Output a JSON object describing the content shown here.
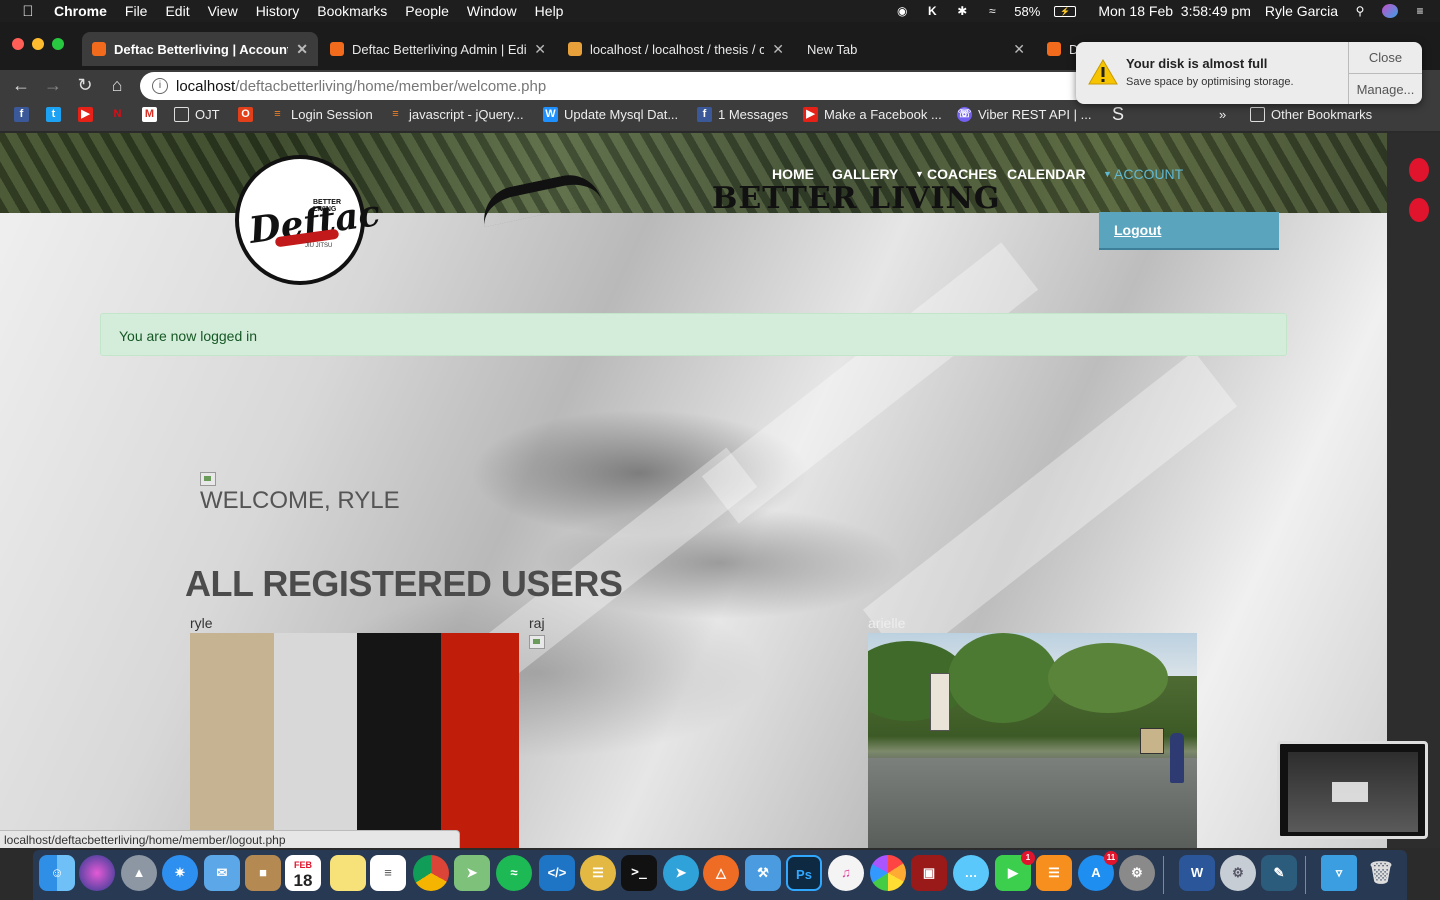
{
  "menubar": {
    "app_name": "Chrome",
    "menus": [
      "File",
      "Edit",
      "View",
      "History",
      "Bookmarks",
      "People",
      "Window",
      "Help"
    ],
    "battery": "58%",
    "datetime": "Mon 18 Feb  3:58:49 pm",
    "user": "Ryle Garcia"
  },
  "tabs": [
    {
      "title": "Deftac Betterliving | Account",
      "active": true
    },
    {
      "title": "Deftac Betterliving Admin | Edi"
    },
    {
      "title": "localhost / localhost / thesis / c"
    },
    {
      "title": "New Tab"
    },
    {
      "title": "D"
    }
  ],
  "toolbar": {
    "url_host": "localhost",
    "url_path": "/deftacbetterliving/home/member/welcome.php"
  },
  "bookmarks": [
    {
      "label": "",
      "icon": "facebook-icon"
    },
    {
      "label": "",
      "icon": "twitter-icon"
    },
    {
      "label": "",
      "icon": "youtube-icon"
    },
    {
      "label": "",
      "icon": "netflix-icon"
    },
    {
      "label": "",
      "icon": "gmail-icon"
    },
    {
      "label": "OJT",
      "icon": "folder-icon"
    },
    {
      "label": "",
      "icon": "office-icon"
    },
    {
      "label": "Login Session",
      "icon": "stackoverflow-icon"
    },
    {
      "label": "javascript - jQuery...",
      "icon": "stackoverflow-icon"
    },
    {
      "label": "Update Mysql Dat...",
      "icon": "w3schools-icon"
    },
    {
      "label": "1 Messages",
      "icon": "facebook-icon"
    },
    {
      "label": "Make a Facebook ...",
      "icon": "youtube-icon"
    },
    {
      "label": "Viber REST API | ...",
      "icon": "viber-icon"
    },
    {
      "label": "S",
      "icon": "text"
    },
    {
      "label": "»",
      "icon": "chevron-icon"
    },
    {
      "label": "Other Bookmarks",
      "icon": "folder-icon"
    }
  ],
  "notification": {
    "title": "Your disk is almost full",
    "body": "Save space by optimising storage.",
    "close_label": "Close",
    "manage_label": "Manage..."
  },
  "page": {
    "banner_text": "BETTER LIVING",
    "logo": {
      "small": "BETTER LIVING",
      "main": "Deftac",
      "sub": "JIU JITSU"
    },
    "nav": [
      "HOME",
      "GALLERY",
      "COACHES",
      "CALENDAR",
      "ACCOUNT"
    ],
    "dropdown_logout": "Logout",
    "alert": "You are now logged in",
    "welcome": "WELCOME, RYLE",
    "all_users_heading": "ALL REGISTERED USERS",
    "users": [
      {
        "name": "ryle",
        "swatch_colors": [
          "#c6b391",
          "#d8d8d8",
          "#151515",
          "#c01d0a"
        ]
      },
      {
        "name": "raj"
      },
      {
        "name": "arielle"
      }
    ]
  },
  "statusbar": "localhost/deftacbetterliving/home/member/logout.php",
  "colors": {
    "nav_active": "#5fb8d2",
    "dropdown_bg": "#5aa4bd",
    "alert_bg": "#d4edda",
    "alert_text": "#155724"
  },
  "dock": {
    "calendar_month": "FEB",
    "calendar_day": "18",
    "facetime_badge": "1",
    "appstore_badge": "11"
  }
}
